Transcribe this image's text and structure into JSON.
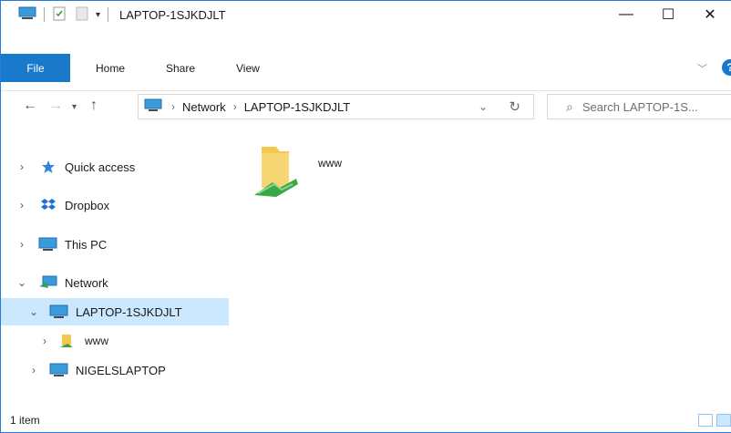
{
  "window": {
    "title": "LAPTOP-1SJKDJLT",
    "controls": {
      "minimize": "—",
      "maximize": "☐",
      "close": "✕"
    }
  },
  "ribbon": {
    "tabs": [
      "File",
      "Home",
      "Share",
      "View"
    ],
    "help": "?"
  },
  "address": {
    "crumbs": [
      "Network",
      "LAPTOP-1SJKDJLT"
    ],
    "search_placeholder": "Search LAPTOP-1S..."
  },
  "navpane": {
    "items": [
      {
        "label": "Quick access",
        "icon": "star-icon",
        "expander": "collapsed"
      },
      {
        "label": "Dropbox",
        "icon": "dropbox-icon",
        "expander": "collapsed"
      },
      {
        "label": "This PC",
        "icon": "computer-icon",
        "expander": "collapsed"
      },
      {
        "label": "Network",
        "icon": "network-icon",
        "expander": "expanded"
      },
      {
        "label": "LAPTOP-1SJKDJLT",
        "icon": "computer-icon",
        "expander": "expanded",
        "selected": true
      },
      {
        "label": "www",
        "icon": "shared-folder-icon",
        "expander": "collapsed"
      },
      {
        "label": "NIGELSLAPTOP",
        "icon": "computer-icon",
        "expander": "collapsed"
      }
    ]
  },
  "content": {
    "items": [
      {
        "label": "www",
        "icon": "shared-folder-icon"
      }
    ]
  },
  "status": {
    "count": "1 item"
  },
  "colors": {
    "accent": "#1979ca",
    "selection": "#cce8ff",
    "border": "#2b7bd6"
  }
}
